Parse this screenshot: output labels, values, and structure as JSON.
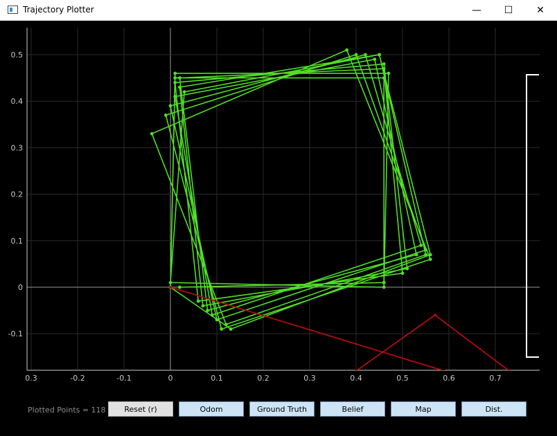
{
  "window": {
    "title": "Trajectory Plotter",
    "minimize": "—",
    "maximize": "☐",
    "close": "✕"
  },
  "status": {
    "plotted_points": "Plotted Points = 118"
  },
  "buttons": [
    {
      "label": "Reset (r)"
    },
    {
      "label": "Odom"
    },
    {
      "label": "Ground Truth"
    },
    {
      "label": "Belief"
    },
    {
      "label": "Map"
    },
    {
      "label": "Dist."
    }
  ],
  "colors": {
    "trajectory": "#4fdf26",
    "odom": "#b00d0d",
    "grid": "#2b2b2b",
    "axis": "#9a9a9a",
    "background": "#000000"
  },
  "chart_data": {
    "type": "line",
    "xlim": [
      -0.31,
      0.79
    ],
    "ylim": [
      -0.18,
      0.55
    ],
    "x_ticks": [
      -0.3,
      -0.2,
      -0.1,
      0,
      0.1,
      0.2,
      0.3,
      0.4,
      0.5,
      0.6,
      0.7
    ],
    "x_tick_labels": [
      "0.3",
      "-0.2",
      "-0.1",
      "0",
      "0.1",
      "0.2",
      "0.3",
      "0.4",
      "0.5",
      "0.6",
      "0.7"
    ],
    "y_ticks": [
      -0.1,
      0,
      0.1,
      0.2,
      0.3,
      0.4,
      0.5
    ],
    "y_tick_labels": [
      "-0.1",
      "0",
      "0.1",
      "0.2",
      "0.3",
      "0.4",
      "0.5"
    ],
    "grid": true,
    "series": [
      {
        "color": "#4fdf26",
        "points": [
          [
            0,
            0
          ],
          [
            0.01,
            0.46
          ],
          [
            0.47,
            0.46
          ],
          [
            0.46,
            0
          ],
          [
            0,
            0.01
          ],
          [
            0.03,
            0.42
          ],
          [
            0.45,
            0.5
          ],
          [
            0.55,
            0.07
          ],
          [
            0.12,
            -0.08
          ],
          [
            -0.04,
            0.33
          ],
          [
            0.38,
            0.51
          ],
          [
            0.56,
            0.06
          ],
          [
            0.11,
            -0.09
          ],
          [
            -0.01,
            0.37
          ],
          [
            0.4,
            0.5
          ],
          [
            0.55,
            0.08
          ],
          [
            0.1,
            -0.07
          ],
          [
            0.0,
            0.39
          ],
          [
            0.42,
            0.5
          ],
          [
            0.54,
            0.09
          ],
          [
            0.09,
            -0.06
          ],
          [
            0.01,
            0.41
          ],
          [
            0.44,
            0.49
          ],
          [
            0.53,
            0.07
          ],
          [
            0.08,
            -0.05
          ],
          [
            0.02,
            0.45
          ],
          [
            0.46,
            0.47
          ],
          [
            0.5,
            0.03
          ],
          [
            0.06,
            -0.03
          ],
          [
            0.01,
            0.44
          ],
          [
            0.46,
            0.48
          ],
          [
            0.51,
            0.04
          ],
          [
            0.07,
            -0.04
          ],
          [
            0.02,
            0.43
          ],
          [
            0.45,
            0.5
          ],
          [
            0.56,
            0.07
          ],
          [
            0.13,
            -0.09
          ],
          [
            0.0,
            0.0
          ],
          [
            0.01,
            0.45
          ],
          [
            0.46,
            0.45
          ],
          [
            0.46,
            0.01
          ],
          [
            0.02,
            0.0
          ]
        ]
      },
      {
        "color": "#b00d0d",
        "points": [
          [
            0,
            0
          ],
          [
            0.59,
            -0.18
          ]
        ]
      },
      {
        "color": "#b00d0d",
        "points": [
          [
            0.4,
            -0.18
          ],
          [
            0.57,
            -0.06
          ],
          [
            0.73,
            -0.18
          ]
        ]
      }
    ]
  }
}
